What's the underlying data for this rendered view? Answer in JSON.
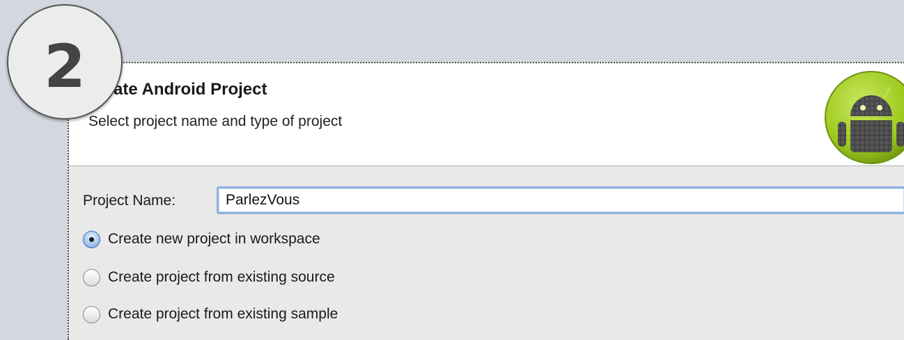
{
  "step_badge": {
    "number": "2"
  },
  "dialog": {
    "title": "Create Android Project",
    "subtitle": "Select project name and type of project",
    "logo_icon": "android-logo-icon"
  },
  "form": {
    "project_name_label": "Project Name:",
    "project_name_value": "ParlezVous",
    "options": [
      {
        "label": "Create new project in workspace",
        "selected": true
      },
      {
        "label": "Create project from existing source",
        "selected": false
      },
      {
        "label": "Create project from existing sample",
        "selected": false
      }
    ]
  },
  "colors": {
    "background": "#d3d8e0",
    "focus_ring": "#8fb1dd",
    "android_green": "#9cc81b"
  }
}
